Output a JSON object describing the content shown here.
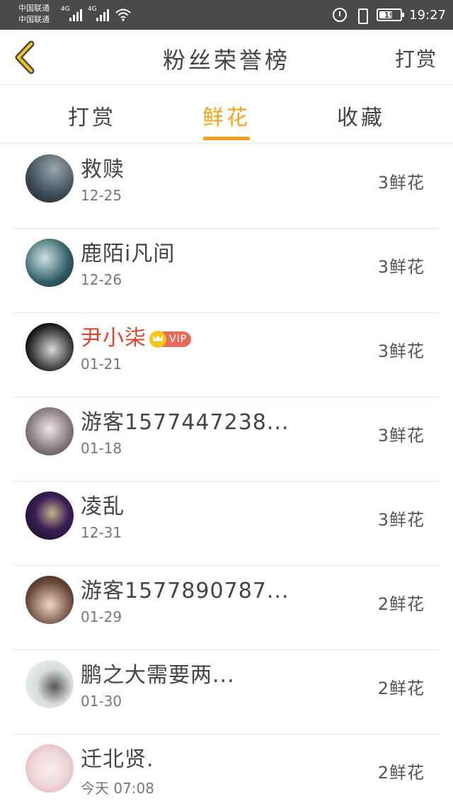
{
  "status_bar": {
    "carrier_1": "中国联通",
    "carrier_2": "中国联通",
    "network_1": "4G",
    "network_2": "4G",
    "battery": "19",
    "time": "19:27"
  },
  "navbar": {
    "title": "粉丝荣誉榜",
    "right_action": "打赏"
  },
  "tabs": [
    {
      "label": "打赏"
    },
    {
      "label": "鲜花",
      "active": true
    },
    {
      "label": "收藏"
    }
  ],
  "fans": [
    {
      "name": "救赎",
      "date": "12-25",
      "amount": "3鲜花",
      "avatar_color": "#3d4a55"
    },
    {
      "name": "鹿陌i凡间",
      "date": "12-26",
      "amount": "3鲜花",
      "avatar_color": "#2f5d66"
    },
    {
      "name": "尹小柒",
      "vip": true,
      "vip_label": "VIP",
      "date": "01-21",
      "amount": "3鲜花",
      "avatar_color": "#1e1e1e"
    },
    {
      "name": "游客1577447238...",
      "date": "01-18",
      "amount": "3鲜花",
      "avatar_color": "#8c7e86"
    },
    {
      "name": "凌乱",
      "date": "12-31",
      "amount": "3鲜花",
      "avatar_color": "#3a1f55"
    },
    {
      "name": "游客1577890787...",
      "date": "01-29",
      "amount": "2鲜花",
      "avatar_color": "#6b4a3a"
    },
    {
      "name": "鹏之大需要两...",
      "date": "01-30",
      "amount": "2鲜花",
      "avatar_color": "#d9dcdc"
    },
    {
      "name": "迁北贤.",
      "date": "今天 07:08",
      "amount": "2鲜花",
      "avatar_color": "#f0d8d8"
    }
  ],
  "colors": {
    "accent": "#f0a21a",
    "vip_name": "#d8452c"
  }
}
